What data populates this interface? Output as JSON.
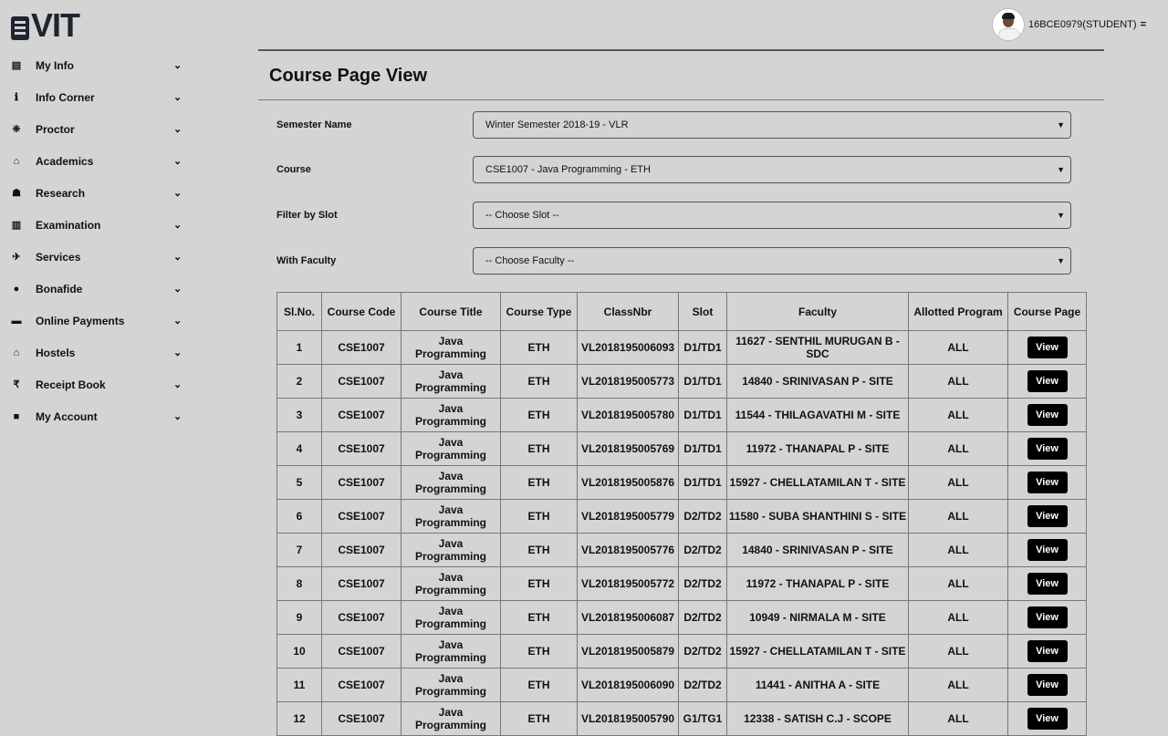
{
  "header": {
    "logo_text": "VIT",
    "user_label": "16BCE0979(STUDENT)",
    "menu_mark": "="
  },
  "sidebar": {
    "items": [
      {
        "label": "My Info",
        "icon": "briefcase-icon",
        "glyph": "▤"
      },
      {
        "label": "Info Corner",
        "icon": "info-icon",
        "glyph": "ℹ"
      },
      {
        "label": "Proctor",
        "icon": "paw-icon",
        "glyph": "❈"
      },
      {
        "label": "Academics",
        "icon": "graduation-cap-icon",
        "glyph": "⌂"
      },
      {
        "label": "Research",
        "icon": "institution-icon",
        "glyph": "☗"
      },
      {
        "label": "Examination",
        "icon": "book-icon",
        "glyph": "▥"
      },
      {
        "label": "Services",
        "icon": "plane-icon",
        "glyph": "✈"
      },
      {
        "label": "Bonafide",
        "icon": "circle-icon",
        "glyph": "●"
      },
      {
        "label": "Online Payments",
        "icon": "visa-card-icon",
        "glyph": "▬"
      },
      {
        "label": "Hostels",
        "icon": "home-icon",
        "glyph": "⌂"
      },
      {
        "label": "Receipt Book",
        "icon": "rupee-icon",
        "glyph": "₹"
      },
      {
        "label": "My Account",
        "icon": "lock-icon",
        "glyph": "■"
      }
    ],
    "chevron": "⌄"
  },
  "main": {
    "title": "Course Page View",
    "form": {
      "semester": {
        "label": "Semester Name",
        "value": "Winter Semester 2018-19 - VLR"
      },
      "course": {
        "label": "Course",
        "value": "CSE1007 - Java Programming - ETH"
      },
      "slot": {
        "label": "Filter by Slot",
        "value": "-- Choose Slot --"
      },
      "faculty": {
        "label": "With Faculty",
        "value": "-- Choose Faculty --"
      }
    },
    "caret": "▼",
    "table": {
      "headers": [
        "Sl.No.",
        "Course Code",
        "Course Title",
        "Course Type",
        "ClassNbr",
        "Slot",
        "Faculty",
        "Allotted Program",
        "Course Page"
      ],
      "button_label": "View",
      "rows": [
        [
          "1",
          "CSE1007",
          "Java Programming",
          "ETH",
          "VL2018195006093",
          "D1/TD1",
          "11627 - SENTHIL MURUGAN B - SDC",
          "ALL"
        ],
        [
          "2",
          "CSE1007",
          "Java Programming",
          "ETH",
          "VL2018195005773",
          "D1/TD1",
          "14840 - SRINIVASAN P - SITE",
          "ALL"
        ],
        [
          "3",
          "CSE1007",
          "Java Programming",
          "ETH",
          "VL2018195005780",
          "D1/TD1",
          "11544 - THILAGAVATHI M - SITE",
          "ALL"
        ],
        [
          "4",
          "CSE1007",
          "Java Programming",
          "ETH",
          "VL2018195005769",
          "D1/TD1",
          "11972 - THANAPAL P - SITE",
          "ALL"
        ],
        [
          "5",
          "CSE1007",
          "Java Programming",
          "ETH",
          "VL2018195005876",
          "D1/TD1",
          "15927 - CHELLATAMILAN T - SITE",
          "ALL"
        ],
        [
          "6",
          "CSE1007",
          "Java Programming",
          "ETH",
          "VL2018195005779",
          "D2/TD2",
          "11580 - SUBA SHANTHINI S - SITE",
          "ALL"
        ],
        [
          "7",
          "CSE1007",
          "Java Programming",
          "ETH",
          "VL2018195005776",
          "D2/TD2",
          "14840 - SRINIVASAN P - SITE",
          "ALL"
        ],
        [
          "8",
          "CSE1007",
          "Java Programming",
          "ETH",
          "VL2018195005772",
          "D2/TD2",
          "11972 - THANAPAL P - SITE",
          "ALL"
        ],
        [
          "9",
          "CSE1007",
          "Java Programming",
          "ETH",
          "VL2018195006087",
          "D2/TD2",
          "10949 - NIRMALA M - SITE",
          "ALL"
        ],
        [
          "10",
          "CSE1007",
          "Java Programming",
          "ETH",
          "VL2018195005879",
          "D2/TD2",
          "15927 - CHELLATAMILAN T - SITE",
          "ALL"
        ],
        [
          "11",
          "CSE1007",
          "Java Programming",
          "ETH",
          "VL2018195006090",
          "D2/TD2",
          "11441 - ANITHA A - SITE",
          "ALL"
        ],
        [
          "12",
          "CSE1007",
          "Java Programming",
          "ETH",
          "VL2018195005790",
          "G1/TG1",
          "12338 - SATISH C.J - SCOPE",
          "ALL"
        ]
      ]
    }
  }
}
